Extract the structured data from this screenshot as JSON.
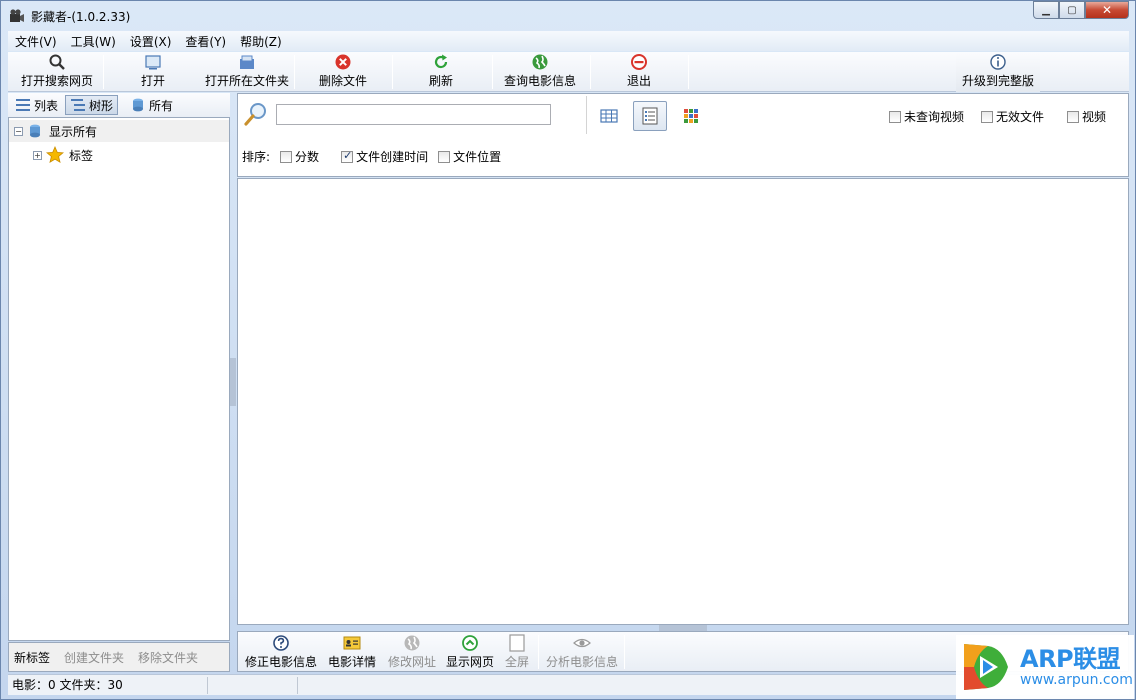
{
  "window": {
    "title": "影藏者-(1.0.2.33)",
    "minimize_glyph": "▁",
    "maximize_glyph": "▢",
    "close_glyph": "✕"
  },
  "menu": [
    {
      "label": "文件(V)"
    },
    {
      "label": "工具(W)"
    },
    {
      "label": "设置(X)"
    },
    {
      "label": "查看(Y)"
    },
    {
      "label": "帮助(Z)"
    }
  ],
  "toolbar": {
    "open_search_web": "打开搜索网页",
    "open": "打开",
    "open_folder": "打开所在文件夹",
    "delete_file": "删除文件",
    "refresh": "刷新",
    "query_movie_info": "查询电影信息",
    "exit": "退出",
    "upgrade": "升级到完整版"
  },
  "left_tabs": {
    "list": "列表",
    "tree": "树形",
    "all": "所有"
  },
  "tree": {
    "show_all": "显示所有",
    "tags": "标签"
  },
  "left_bottom": {
    "new_tag": "新标签",
    "create_folder": "创建文件夹",
    "remove_folder": "移除文件夹"
  },
  "search": {
    "value": "",
    "placeholder": ""
  },
  "filters": {
    "unqueried_video": "未查询视频",
    "invalid_file": "无效文件",
    "video": "视频"
  },
  "sort": {
    "label": "排序:",
    "score": "分数",
    "created_time": "文件创建时间",
    "location": "文件位置",
    "created_time_checked": true
  },
  "bottom_toolbar": {
    "fix_movie_info": "修正电影信息",
    "movie_details": "电影详情",
    "modify_url": "修改网址",
    "show_webpage": "显示网页",
    "fullscreen": "全屏",
    "analyze_movie_info": "分析电影信息"
  },
  "status": {
    "summary": "电影：0 文件夹：30"
  },
  "watermark": {
    "brand": "ARP联盟",
    "url": "www.arpun.com"
  },
  "colors": {
    "accent": "#2c8ee6",
    "delete_red": "#d9342b",
    "refresh_green": "#2fa23a",
    "exit_red": "#d9342b"
  }
}
